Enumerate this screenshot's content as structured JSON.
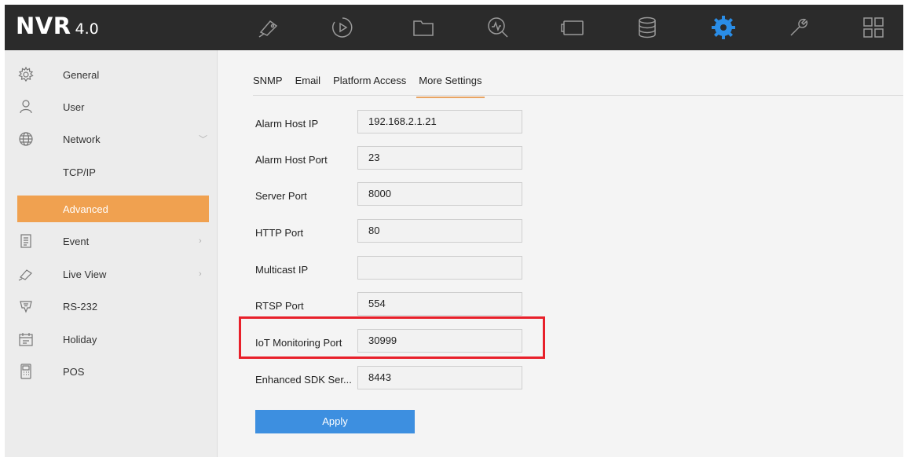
{
  "header": {
    "logo_main": "NVR",
    "logo_version": "4.0",
    "nav_icons": [
      "live-view-camera-icon",
      "playback-icon",
      "file-folder-icon",
      "smart-analysis-icon",
      "camera-management-icon",
      "storage-icon",
      "configuration-gear-icon",
      "maintenance-wrench-icon",
      "menu-grid-icon"
    ],
    "active_icon": "configuration-gear-icon",
    "accent_color": "#2a8de6"
  },
  "sidebar": {
    "items": [
      {
        "label": "General",
        "icon": "gear-outline-icon"
      },
      {
        "label": "User",
        "icon": "user-icon"
      },
      {
        "label": "Network",
        "icon": "globe-icon",
        "chevron": "﹀"
      },
      {
        "label": "TCP/IP"
      },
      {
        "label": "Advanced",
        "active": true
      },
      {
        "label": "Event",
        "icon": "clipboard-icon",
        "chevron": "›"
      },
      {
        "label": "Live View",
        "icon": "camera-icon",
        "chevron": "›"
      },
      {
        "label": "RS-232",
        "icon": "rs232-port-icon"
      },
      {
        "label": "Holiday",
        "icon": "calendar-icon"
      },
      {
        "label": "POS",
        "icon": "pos-terminal-icon"
      }
    ],
    "active_color": "#f0a150"
  },
  "tabs": [
    {
      "label": "SNMP"
    },
    {
      "label": "Email"
    },
    {
      "label": "Platform Access"
    },
    {
      "label": "More Settings",
      "active": true
    }
  ],
  "fields": [
    {
      "label": "Alarm Host IP",
      "value": "192.168.2.1.21"
    },
    {
      "label": "Alarm Host Port",
      "value": "23"
    },
    {
      "label": "Server Port",
      "value": "8000"
    },
    {
      "label": "HTTP Port",
      "value": "80"
    },
    {
      "label": "Multicast IP",
      "value": ""
    },
    {
      "label": "RTSP Port",
      "value": "554"
    },
    {
      "label": "IoT Monitoring Port",
      "value": "30999",
      "highlighted": true
    },
    {
      "label": "Enhanced SDK Ser...",
      "value": "8443"
    }
  ],
  "apply_label": "Apply",
  "highlight_color": "#e8202a",
  "button_color": "#3d8fe0"
}
